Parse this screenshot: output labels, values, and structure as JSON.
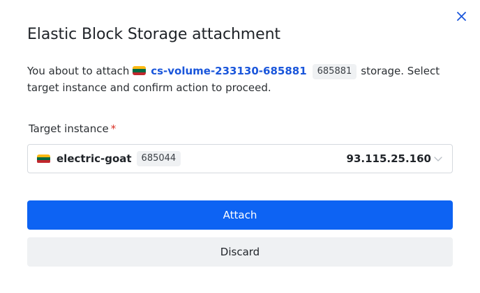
{
  "dialog": {
    "title": "Elastic Block Storage attachment",
    "close_icon": "close-icon",
    "description": {
      "prefix": "You about to attach",
      "volume_name": "cs-volume-233130-685881",
      "volume_id": "685881",
      "suffix": "storage. Select target instance and confirm action to proceed."
    },
    "target": {
      "label": "Target instance",
      "required_mark": "*",
      "selected": {
        "name": "electric-goat",
        "id": "685044",
        "ip": "93.115.25.160"
      },
      "chevron_icon": "chevron-down-icon"
    },
    "actions": {
      "attach_label": "Attach",
      "discard_label": "Discard"
    }
  },
  "colors": {
    "primary": "#0d63f3",
    "link": "#1a56db",
    "required": "#d93025",
    "tag_bg": "#eff1f3",
    "flag_lithuania": [
      "#fdb913",
      "#006a44",
      "#c1272d"
    ]
  }
}
